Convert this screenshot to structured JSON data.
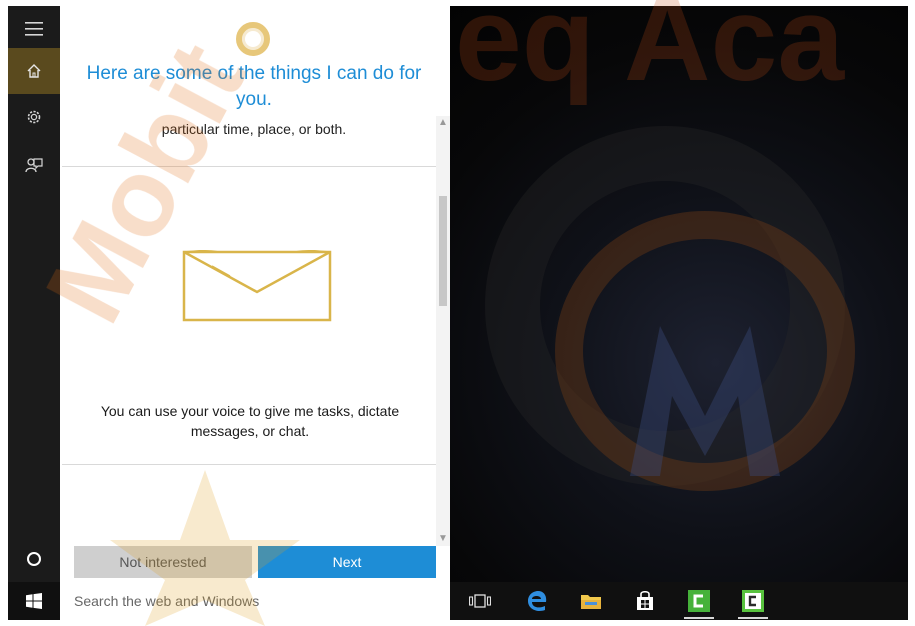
{
  "rail": {
    "items": [
      {
        "icon": "hamburger-menu-icon",
        "active": false
      },
      {
        "icon": "home-icon",
        "active": true
      },
      {
        "icon": "gear-icon",
        "active": false
      },
      {
        "icon": "feedback-icon",
        "active": false
      }
    ],
    "bottom_icon": "cortana-circle-icon"
  },
  "cortana": {
    "headline": "Here are some of the things I can do for you.",
    "subline": "particular time, place, or both.",
    "card_text": "You can use your voice to give me tasks, dictate messages, or chat.",
    "buttons": {
      "secondary": "Not interested",
      "primary": "Next"
    }
  },
  "taskbar": {
    "search_placeholder": "Search the web and Windows",
    "pinned": [
      {
        "icon": "task-view-icon"
      },
      {
        "icon": "edge-browser-icon"
      },
      {
        "icon": "file-explorer-icon"
      },
      {
        "icon": "store-icon"
      },
      {
        "icon": "camtasia-icon"
      },
      {
        "icon": "camtasia-recorder-icon"
      }
    ]
  },
  "watermark": {
    "text": "Mobiteq Academy"
  },
  "colors": {
    "accent_blue": "#1e8dd6",
    "cortana_gold": "#d9b54a",
    "rail_bg": "#1b1b1b",
    "rail_active": "#5a4a1e",
    "taskbar_bg": "#101010"
  }
}
